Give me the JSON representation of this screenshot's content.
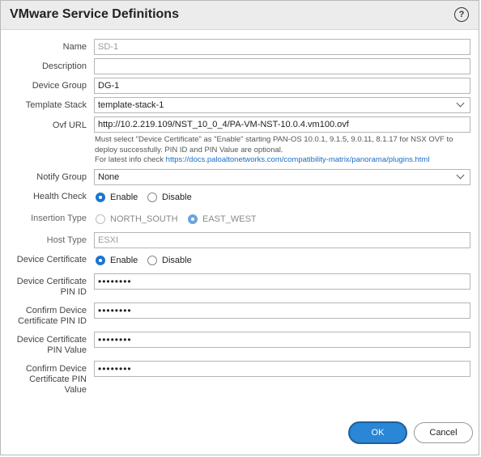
{
  "dialog": {
    "title": "VMware Service Definitions",
    "help_icon": "question-circle-icon"
  },
  "fields": {
    "name": {
      "label": "Name",
      "placeholder": "SD-1"
    },
    "description": {
      "label": "Description",
      "value": ""
    },
    "device_group": {
      "label": "Device Group",
      "value": "DG-1"
    },
    "template_stack": {
      "label": "Template Stack",
      "value": "template-stack-1"
    },
    "ovf_url": {
      "label": "Ovf URL",
      "value": "http://10.2.219.109/NST_10_0_4/PA-VM-NST-10.0.4.vm100.ovf"
    },
    "ovf_help": {
      "line1": "Must select \"Device Certificate\" as \"Enable\" starting PAN-OS 10.0.1, 9.1.5, 9.0.11, 8.1.17 for NSX OVF to",
      "line2": "deploy successfully. PIN ID and PIN Value are optional.",
      "line3_prefix": "For latest info check ",
      "line3_link": "https://docs.paloaltonetworks.com/compatibility-matrix/panorama/plugins.html"
    },
    "notify_group": {
      "label": "Notify Group",
      "value": "None"
    },
    "health_check": {
      "label": "Health Check",
      "option1": "Enable",
      "option2": "Disable",
      "selected": "Enable"
    },
    "insertion_type": {
      "label": "Insertion Type",
      "option1": "NORTH_SOUTH",
      "option2": "EAST_WEST",
      "selected": "EAST_WEST"
    },
    "host_type": {
      "label": "Host Type",
      "value": "ESXI"
    },
    "device_certificate": {
      "label": "Device Certificate",
      "option1": "Enable",
      "option2": "Disable",
      "selected": "Enable"
    },
    "pin_id": {
      "label_line1": "Device Certificate",
      "label_line2": "PIN ID",
      "value": "••••••••"
    },
    "confirm_pin_id": {
      "label_line1": "Confirm Device",
      "label_line2": "Certificate PIN ID",
      "value": "••••••••"
    },
    "pin_value": {
      "label_line1": "Device Certificate",
      "label_line2": "PIN Value",
      "value": "••••••••"
    },
    "confirm_pin_value": {
      "label_line1": "Confirm Device",
      "label_line2": "Certificate PIN",
      "label_line3": "Value",
      "value": "••••••••"
    }
  },
  "buttons": {
    "ok": "OK",
    "cancel": "Cancel"
  },
  "colors": {
    "accent": "#2a86d6",
    "link": "#1a6ec5",
    "titlebar": "#ececec"
  }
}
